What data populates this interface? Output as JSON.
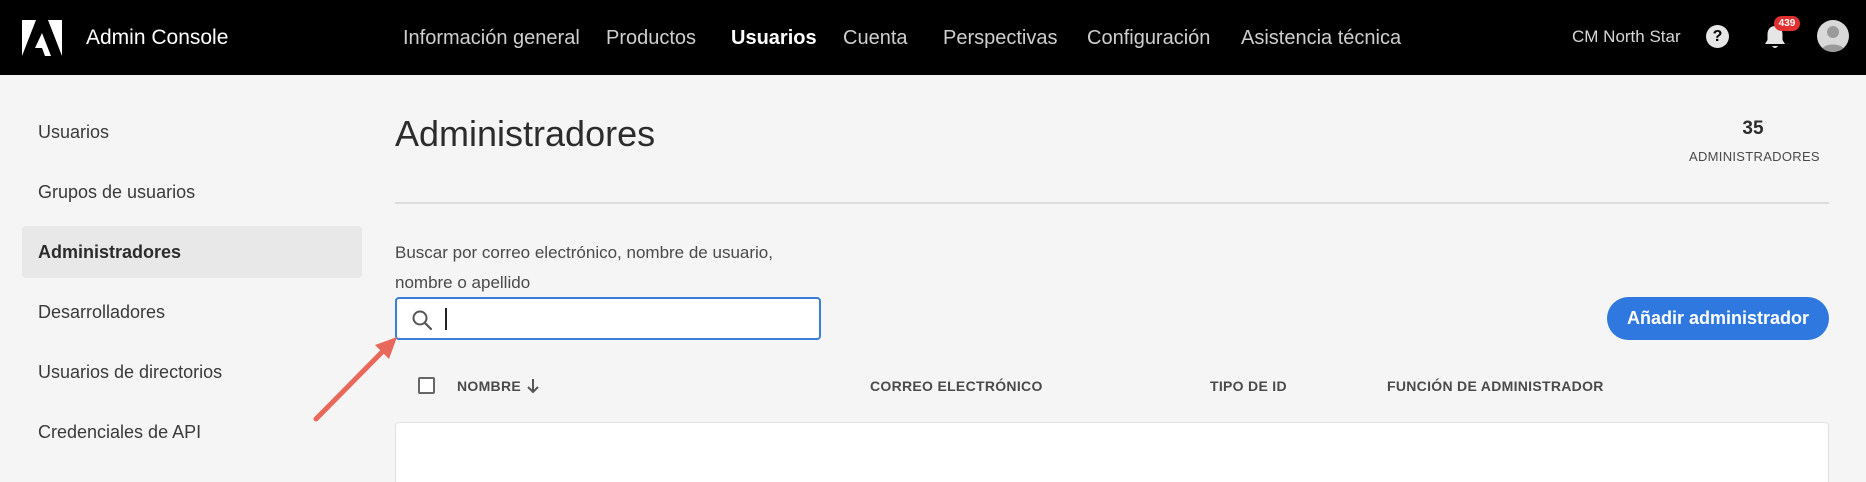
{
  "app": {
    "title": "Admin Console"
  },
  "nav": {
    "items": [
      {
        "label": "Información general"
      },
      {
        "label": "Productos"
      },
      {
        "label": "Usuarios"
      },
      {
        "label": "Cuenta"
      },
      {
        "label": "Perspectivas"
      },
      {
        "label": "Configuración"
      },
      {
        "label": "Asistencia técnica"
      }
    ],
    "active": "Usuarios"
  },
  "header": {
    "org_name": "CM North Star",
    "help_glyph": "?",
    "notifications_count": "439"
  },
  "sidebar": {
    "items": [
      {
        "label": "Usuarios"
      },
      {
        "label": "Grupos de usuarios"
      },
      {
        "label": "Administradores"
      },
      {
        "label": "Desarrolladores"
      },
      {
        "label": "Usuarios de directorios"
      },
      {
        "label": "Credenciales de API"
      }
    ],
    "active": "Administradores"
  },
  "main": {
    "title": "Administradores",
    "count": {
      "value": "35",
      "label": "ADMINISTRADORES"
    },
    "search": {
      "label": "Buscar por correo electrónico, nombre de usuario, nombre o apellido",
      "value": ""
    },
    "add_button_label": "Añadir administrador",
    "table": {
      "columns": [
        {
          "label": "NOMBRE"
        },
        {
          "label": "CORREO ELECTRÓNICO"
        },
        {
          "label": "TIPO DE ID"
        },
        {
          "label": "FUNCIÓN DE ADMINISTRADOR"
        }
      ]
    }
  },
  "colors": {
    "accent": "#2f78e0",
    "annotation_arrow": "#e8695b",
    "topbar": "#000000"
  }
}
